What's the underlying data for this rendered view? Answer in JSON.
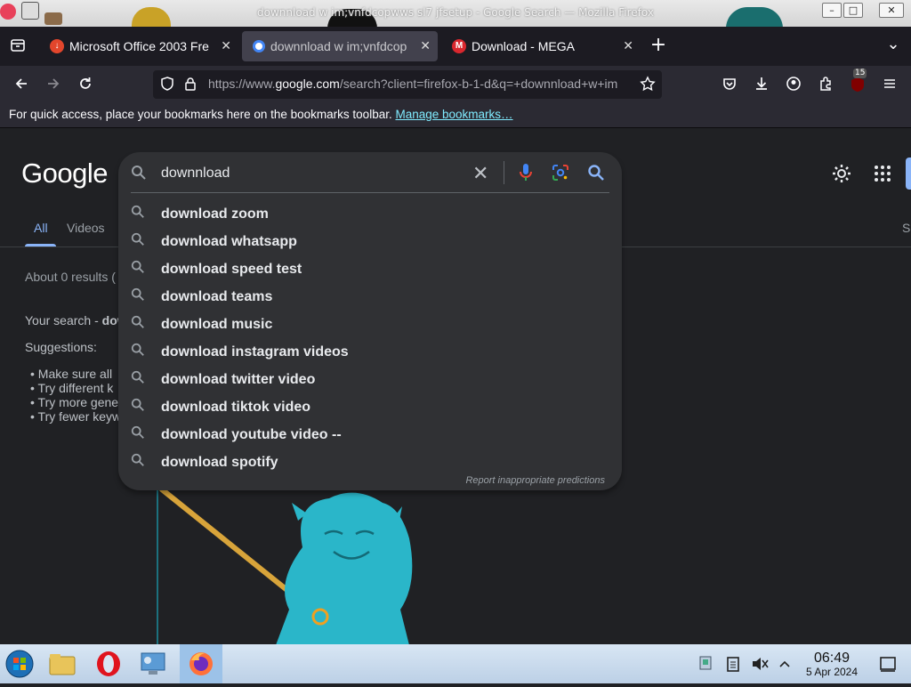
{
  "window": {
    "title": "downnload w im;vnfdcopwws sl7 jfsetup - Google Search — Mozilla Firefox",
    "minimize": "–",
    "maximize": "□",
    "close": "✕"
  },
  "tabs": [
    {
      "label": "Microsoft Office 2003 Fre",
      "close": "✕",
      "icon": "download-red-favicon"
    },
    {
      "label": "downnload w im;vnfdcop",
      "close": "✕",
      "icon": "google-favicon"
    },
    {
      "label": "Download - MEGA",
      "close": "✕",
      "icon": "mega-favicon",
      "favicon_letter": "M"
    }
  ],
  "tabstrip": {
    "new_tab": "+",
    "list_all": "⌄"
  },
  "navbar": {
    "url_prefix": "https://www.",
    "url_domain": "google.com",
    "url_rest": "/search?client=firefox-b-1-d&q=+downnload+w+im",
    "extension_badge": "15"
  },
  "bookmarks_bar": {
    "message": "For quick access, place your bookmarks here on the bookmarks toolbar.",
    "link": "Manage bookmarks…"
  },
  "google": {
    "logo": "Google",
    "tabs": [
      "All",
      "Videos"
    ],
    "right_partial": "S",
    "results_count": "About 0 results (",
    "your_search_prefix": "Your search - ",
    "your_search_query": "dow",
    "suggestions_heading": "Suggestions:",
    "suggestion_bullets": [
      "Make sure all",
      "Try different k",
      "Try more gene",
      "Try fewer keyw"
    ]
  },
  "search": {
    "query": "downnload",
    "clear_icon": "✕",
    "suggestions": [
      "download zoom",
      "download whatsapp",
      "download speed test",
      "download teams",
      "download music",
      "download instagram videos",
      "download twitter video",
      "download tiktok video",
      "download youtube video --",
      "download spotify"
    ],
    "report": "Report inappropriate predictions"
  },
  "taskbar": {
    "time": "06:49",
    "date": "5 Apr 2024"
  },
  "colors": {
    "accent_blue": "#8ab4f8",
    "link_cyan": "#80ebff",
    "mascot": "#2ab6c9"
  }
}
